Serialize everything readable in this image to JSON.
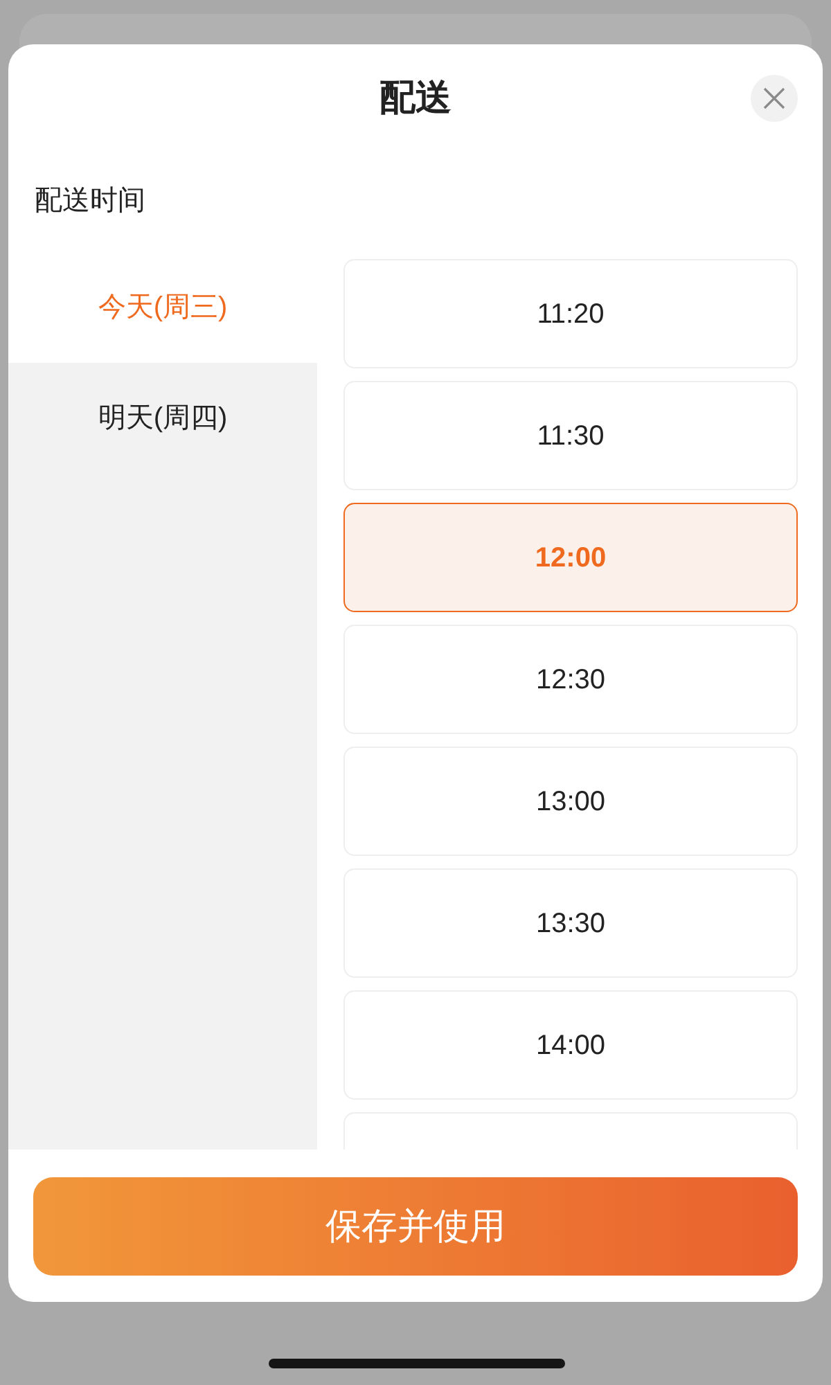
{
  "dialog": {
    "title": "配送",
    "section_label": "配送时间"
  },
  "days": [
    {
      "label": "今天(周三)",
      "selected": true
    },
    {
      "label": "明天(周四)",
      "selected": false
    }
  ],
  "time_slots": [
    {
      "label": "11:20",
      "selected": false
    },
    {
      "label": "11:30",
      "selected": false
    },
    {
      "label": "12:00",
      "selected": true
    },
    {
      "label": "12:30",
      "selected": false
    },
    {
      "label": "13:00",
      "selected": false
    },
    {
      "label": "13:30",
      "selected": false
    },
    {
      "label": "14:00",
      "selected": false
    },
    {
      "selected": false
    }
  ],
  "save_button": "保存并使用"
}
